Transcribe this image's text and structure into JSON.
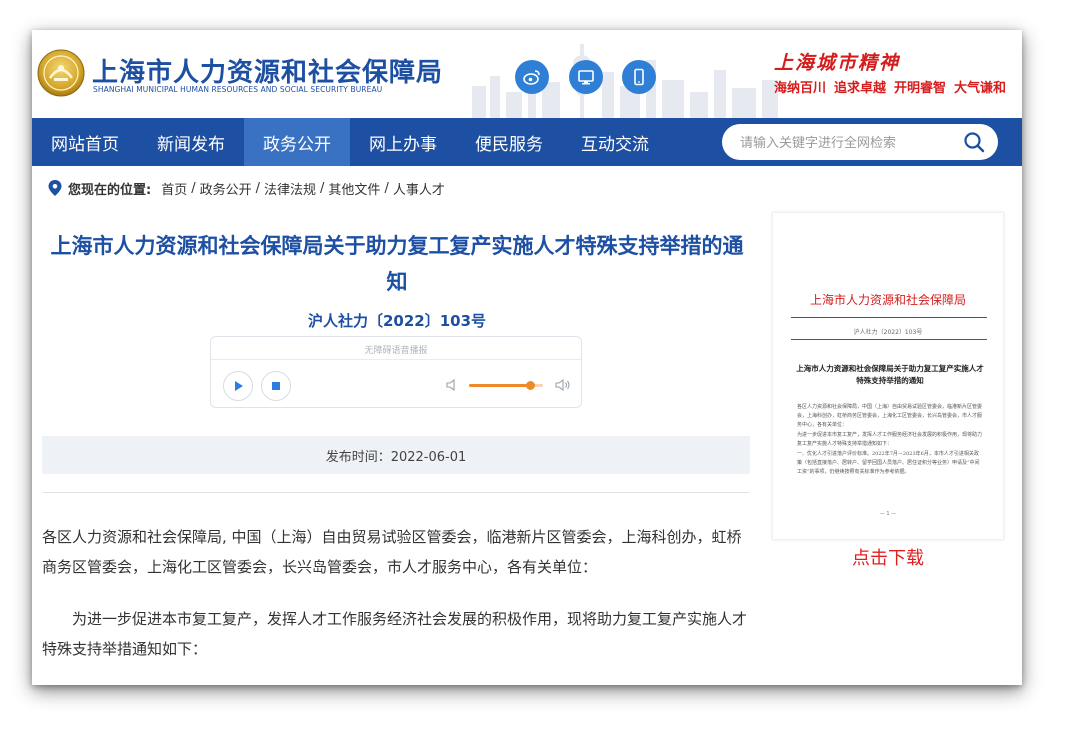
{
  "header": {
    "site_name": "上海市人力资源和社会保障局",
    "site_name_en": "SHANGHAI MUNICIPAL HUMAN RESOURCES AND SOCIAL SECURITY BUREAU",
    "social_icons": [
      "weibo-icon",
      "desktop-icon",
      "mobile-icon"
    ],
    "spirit_title": "上海城市精神",
    "spirit_words": [
      "海纳百川",
      "追求卓越",
      "开明睿智",
      "大气谦和"
    ],
    "colors": {
      "brand": "#1d4fa3",
      "accent": "#d61d1d"
    }
  },
  "nav": {
    "items": [
      {
        "label": "网站首页",
        "active": false
      },
      {
        "label": "新闻发布",
        "active": false
      },
      {
        "label": "政务公开",
        "active": true
      },
      {
        "label": "网上办事",
        "active": false
      },
      {
        "label": "便民服务",
        "active": false
      },
      {
        "label": "互动交流",
        "active": false
      }
    ],
    "search_placeholder": "请输入关键字进行全网检索"
  },
  "breadcrumb": {
    "label": "您现在的位置:",
    "items": [
      "首页",
      "政务公开",
      "法律法规",
      "其他文件",
      "人事人才"
    ],
    "separator": "/"
  },
  "article": {
    "title": "上海市人力资源和社会保障局关于助力复工复产实施人才特殊支持举措的通知",
    "doc_number": "沪人社力〔2022〕103号",
    "player": {
      "caption": "无障碍语音播报",
      "volume": 0.82
    },
    "publish_time": "发布时间：2022-06-01",
    "paragraph_1": "各区人力资源和社会保障局, 中国（上海）自由贸易试验区管委会，临港新片区管委会，上海科创办，虹桥商务区管委会，上海化工区管委会，长兴岛管委会，市人才服务中心，各有关单位：",
    "paragraph_2": "为进一步促进本市复工复产，发挥人才工作服务经济社会发展的积极作用，现将助力复工复产实施人才特殊支持举措通知如下："
  },
  "thumbnail": {
    "header": "上海市人力资源和社会保障局",
    "doc_number": "沪人社力〔2022〕103号",
    "title": "上海市人力资源和社会保障局关于助力复工复产实施人才特殊支持举措的通知",
    "body": [
      "各区人力资源和社会保障局，中国（上海）自由贸易试验区管委会，临港新片区管委会，上海科创办，虹桥商务区管委会，上海化工区管委会，长兴岛管委会，市人才服务中心，各有关单位：",
      "为进一步促进本市复工复产，发挥人才工作服务经济社会发展的积极作用，现将助力复工复产实施人才特殊支持举措通知如下：",
      "一、优化人才引进落户评价标准。2022年7月—2023年6月，本市人才引进相关政策（包括直接落户、居转户、留学回国人员落户、居住证积分等业务）申请及“中间工资”的事项，仍继续按照有关标准作为参考依据。"
    ],
    "page": "— 1 —"
  },
  "download_label": "点击下载"
}
